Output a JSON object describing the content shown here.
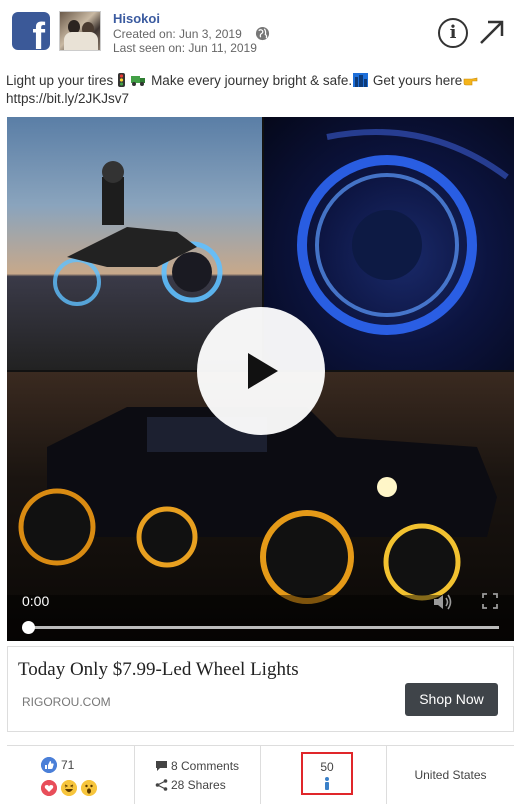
{
  "page": {
    "name": "Hisokoi",
    "created": "Created on: Jun 3, 2019",
    "last_seen": "Last seen on: Jun 11, 2019"
  },
  "post": {
    "text_part1": "Light up your tires",
    "text_part2": " Make every journey bright & safe.",
    "text_part3": " Get yours here",
    "link": "https://bit.ly/2JKJsv7"
  },
  "video": {
    "time": "0:00",
    "progress": 0
  },
  "cta": {
    "headline": "Today Only $7.99-Led Wheel Lights",
    "domain": "RIGOROU.COM",
    "button": "Shop Now"
  },
  "stats": {
    "likes": "71",
    "comments": "8 Comments",
    "shares": "28 Shares",
    "reach": "50",
    "country": "United States"
  },
  "colors": {
    "facebook_blue": "#3b5998",
    "page_name": "#3b5ba0",
    "cta_button": "#3f4449",
    "highlight": "#e0262a",
    "like": "#4a7fd8",
    "love": "#e84e5a"
  },
  "icons": [
    "facebook-logo-icon",
    "globe-icon",
    "info-icon",
    "open-external-icon",
    "play-icon",
    "volume-icon",
    "fullscreen-icon",
    "like-icon",
    "love-icon",
    "haha-icon",
    "wow-icon",
    "comment-icon",
    "share-icon",
    "person-icon"
  ]
}
